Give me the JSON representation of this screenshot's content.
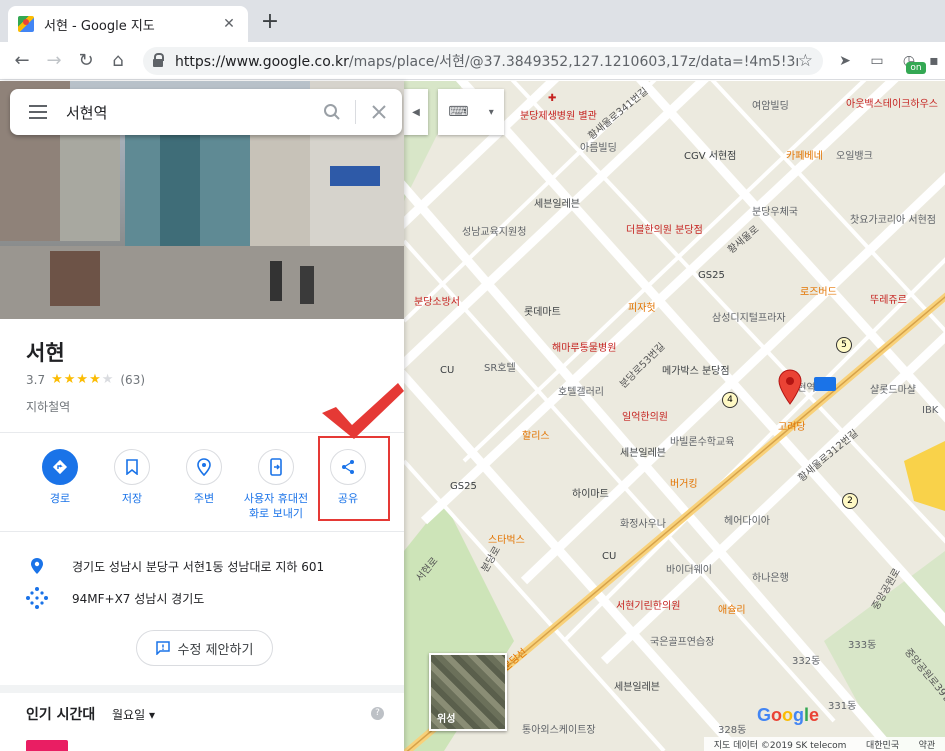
{
  "browser": {
    "tab_title": "서현 - Google 지도",
    "url_host": "https://www.google.co.kr",
    "url_path": "/maps/place/서현/@37.3849352,127.1210603,17z/data=!4m5!3m4!1s...",
    "ext_badge": "on"
  },
  "search": {
    "value": "서현역"
  },
  "place": {
    "title": "서현",
    "rating": "3.7",
    "review_count": "(63)",
    "category": "지하철역"
  },
  "actions": [
    {
      "label": "경로"
    },
    {
      "label": "저장"
    },
    {
      "label": "주변"
    },
    {
      "label": "사용자 휴대전\n화로 보내기"
    },
    {
      "label": "공유"
    }
  ],
  "info": {
    "address": "경기도 성남시 분당구 서현1동 성남대로 지하 601",
    "plus_code": "94MF+X7 성남시 경기도"
  },
  "suggest_edit": "수정 제안하기",
  "popular_times": {
    "title": "인기 시간대",
    "day": "월요일"
  },
  "map": {
    "satellite_label": "위성",
    "google_logo": "Google",
    "footer": {
      "data": "지도 데이터 ©2019 SK telecom",
      "country": "대한민국",
      "terms": "약관"
    },
    "pois": [
      {
        "label": "분당제생병원 별관",
        "kind": "red"
      },
      {
        "label": "아름빌딩",
        "kind": "grey"
      },
      {
        "label": "CGV 서현점",
        "kind": "blue"
      },
      {
        "label": "카페베네",
        "kind": "orange"
      },
      {
        "label": "오일뱅크",
        "kind": "grey"
      },
      {
        "label": "여암빌딩",
        "kind": "grey"
      },
      {
        "label": "아웃백스테이크하우스",
        "kind": "red"
      },
      {
        "label": "세븐일레븐",
        "kind": "blue"
      },
      {
        "label": "분당우체국",
        "kind": "grey"
      },
      {
        "label": "찻요가코리아 서현점",
        "kind": "grey"
      },
      {
        "label": "성남교육지원청",
        "kind": "grey"
      },
      {
        "label": "더블한의원 분당점",
        "kind": "red"
      },
      {
        "label": "GS25",
        "kind": "blue"
      },
      {
        "label": "로즈버드",
        "kind": "orange"
      },
      {
        "label": "뚜레쥬르",
        "kind": "red"
      },
      {
        "label": "분당소방서",
        "kind": "red"
      },
      {
        "label": "롯데마트",
        "kind": "blue"
      },
      {
        "label": "피자헛",
        "kind": "orange"
      },
      {
        "label": "삼성디지털프라자",
        "kind": "grey"
      },
      {
        "label": "해마루통물병원",
        "kind": "red"
      },
      {
        "label": "SR호텔",
        "kind": "grey"
      },
      {
        "label": "메가박스 분당점",
        "kind": "blue"
      },
      {
        "label": "CU",
        "kind": "blue"
      },
      {
        "label": "호텔갤러리",
        "kind": "grey"
      },
      {
        "label": "서현역",
        "kind": "grey"
      },
      {
        "label": "샬롯드마샬",
        "kind": "grey"
      },
      {
        "label": "일억한의원",
        "kind": "red"
      },
      {
        "label": "고려당",
        "kind": "orange"
      },
      {
        "label": "할리스",
        "kind": "orange"
      },
      {
        "label": "바빌론수학교육",
        "kind": "grey"
      },
      {
        "label": "세븐일레븐",
        "kind": "blue"
      },
      {
        "label": "GS25",
        "kind": "blue"
      },
      {
        "label": "하이마트",
        "kind": "blue"
      },
      {
        "label": "버거킹",
        "kind": "orange"
      },
      {
        "label": "헤어다이아",
        "kind": "grey"
      },
      {
        "label": "화정사우나",
        "kind": "grey"
      },
      {
        "label": "스타벅스",
        "kind": "orange"
      },
      {
        "label": "CU",
        "kind": "blue"
      },
      {
        "label": "바이더웨이",
        "kind": "grey"
      },
      {
        "label": "하나은행",
        "kind": "grey"
      },
      {
        "label": "애슐리",
        "kind": "orange"
      },
      {
        "label": "서현기린한의원",
        "kind": "red"
      },
      {
        "label": "국은골프연습장",
        "kind": "grey"
      },
      {
        "label": "세븐일레븐",
        "kind": "blue"
      },
      {
        "label": "통아외스케이트장",
        "kind": "grey"
      },
      {
        "label": "IBK",
        "kind": "grey"
      },
      {
        "label": "333동",
        "kind": "grey"
      },
      {
        "label": "332동",
        "kind": "grey"
      },
      {
        "label": "331동",
        "kind": "grey"
      },
      {
        "label": "328동",
        "kind": "grey"
      }
    ],
    "road_labels": [
      {
        "label": "황새울로"
      },
      {
        "label": "황새울로312번길"
      },
      {
        "label": "분당로"
      },
      {
        "label": "분당로53번길"
      },
      {
        "label": "중앙공원로"
      },
      {
        "label": "중앙공원로39번길"
      },
      {
        "label": "분당선"
      },
      {
        "label": "서현로"
      },
      {
        "label": "황새울로341번길"
      }
    ],
    "route_badges": [
      "5",
      "4",
      "2"
    ]
  },
  "colors": {
    "accent_blue": "#1a73e8",
    "star_yellow": "#fbbc04",
    "highlight_red": "#e53935",
    "pin_red": "#ea4335",
    "map_bg": "#eceadf"
  }
}
